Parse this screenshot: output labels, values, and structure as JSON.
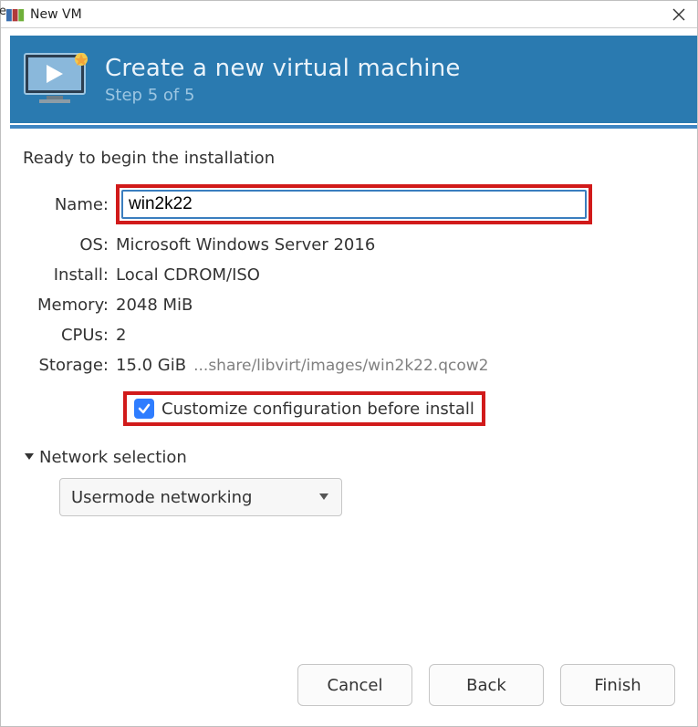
{
  "window": {
    "title": "New VM",
    "app_icon_name": "vm-manager-icon"
  },
  "banner": {
    "heading": "Create a new virtual machine",
    "step": "Step 5 of 5"
  },
  "content": {
    "ready": "Ready to begin the installation",
    "labels": {
      "name": "Name:",
      "os": "OS:",
      "install": "Install:",
      "memory": "Memory:",
      "cpus": "CPUs:",
      "storage": "Storage:"
    },
    "name_value": "win2k22",
    "os_value": "Microsoft Windows Server 2016",
    "install_value": "Local CDROM/ISO",
    "memory_value": "2048 MiB",
    "cpus_value": "2",
    "storage_size": "15.0 GiB",
    "storage_path": "...share/libvirt/images/win2k22.qcow2",
    "customize_checked": true,
    "customize_label": "Customize configuration before install"
  },
  "network": {
    "header": "Network selection",
    "selected": "Usermode networking"
  },
  "buttons": {
    "cancel": "Cancel",
    "back": "Back",
    "finish": "Finish"
  },
  "truncated_left_text": "e"
}
